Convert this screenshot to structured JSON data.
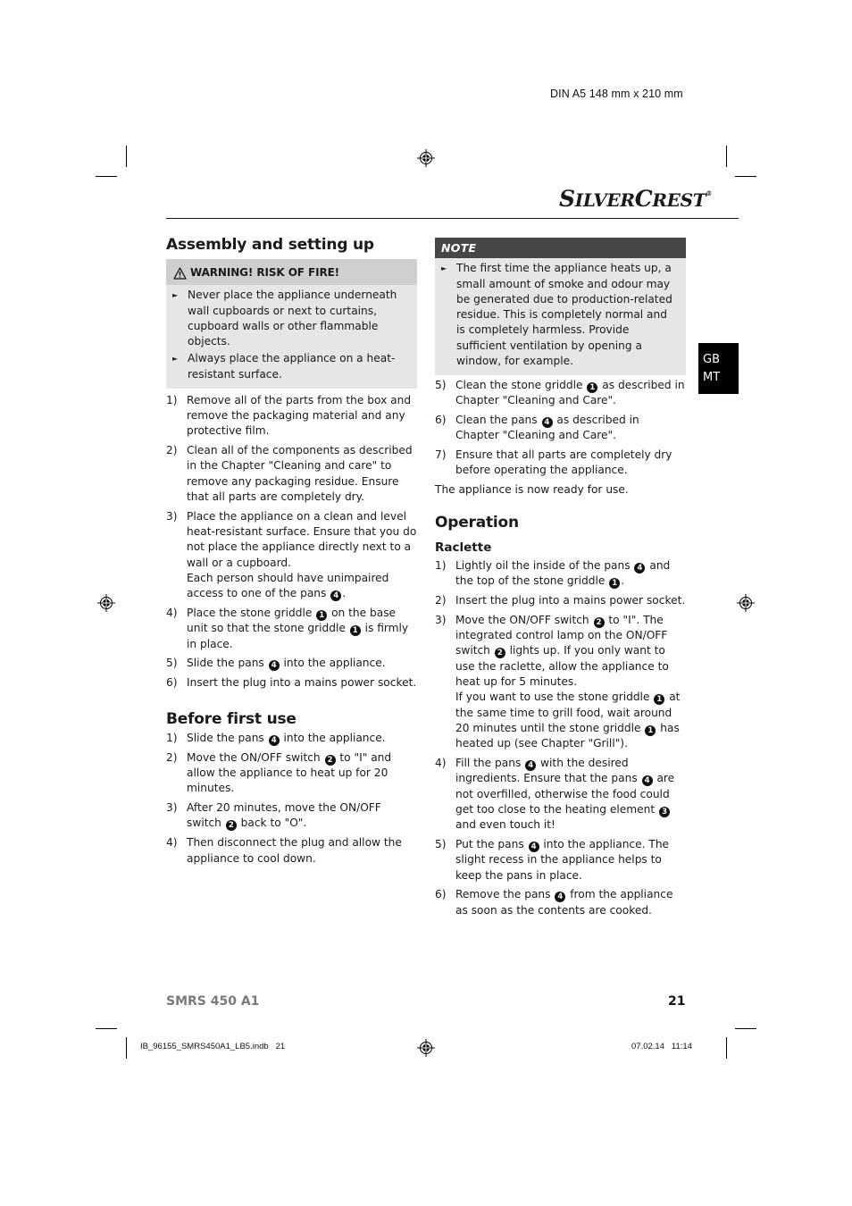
{
  "print_info": {
    "format": "DIN A5 148 mm x 210 mm",
    "slug_file": "IB_96155_SMRS450A1_LB5.indb   21",
    "slug_date": "07.02.14   11:14"
  },
  "header": {
    "brand": {
      "s": "S",
      "ilver": "ILVER",
      "c": "C",
      "rest": "REST",
      "mark": "®"
    }
  },
  "language_tab": {
    "line1": "GB",
    "line2": "MT"
  },
  "left_column": {
    "assembly": {
      "title": "Assembly and setting up",
      "warning": {
        "icon": "warning-triangle-icon",
        "title": "WARNING! RISK OF FIRE!",
        "bullets": [
          "Never place the appliance underneath wall cupboards or next to curtains, cupboard walls or other flammable objects.",
          "Always place the appliance on a heat-resistant surface."
        ]
      },
      "steps": [
        {
          "num": "1)",
          "parts": [
            {
              "t": "Remove all of the parts from the box and remove the packaging material and any protective film."
            }
          ]
        },
        {
          "num": "2)",
          "parts": [
            {
              "t": "Clean all of the components as described in the Chapter \"Cleaning and care\" to remove any packaging residue. Ensure that all parts are completely dry."
            }
          ]
        },
        {
          "num": "3)",
          "parts": [
            {
              "t": "Place the appliance on a clean and level heat-resistant surface. Ensure that you do not place the appliance directly next to a wall or a cupboard."
            },
            {
              "br": true
            },
            {
              "t": "Each person should have unimpaired access to one of the pans "
            },
            {
              "badge": "4"
            },
            {
              "t": "."
            }
          ]
        },
        {
          "num": "4)",
          "parts": [
            {
              "t": "Place the stone griddle "
            },
            {
              "badge": "1"
            },
            {
              "t": " on the base unit so that the stone griddle "
            },
            {
              "badge": "1"
            },
            {
              "t": " is firmly in place."
            }
          ]
        },
        {
          "num": "5)",
          "parts": [
            {
              "t": "Slide the pans "
            },
            {
              "badge": "4"
            },
            {
              "t": " into the appliance."
            }
          ]
        },
        {
          "num": "6)",
          "parts": [
            {
              "t": "Insert the plug into a mains power socket."
            }
          ]
        }
      ]
    },
    "before_first_use": {
      "title": "Before first use",
      "steps": [
        {
          "num": "1)",
          "parts": [
            {
              "t": "Slide the pans "
            },
            {
              "badge": "4"
            },
            {
              "t": " into the appliance."
            }
          ]
        },
        {
          "num": "2)",
          "parts": [
            {
              "t": "Move the ON/OFF switch "
            },
            {
              "badge": "2"
            },
            {
              "t": " to \"I\" and allow the appliance to heat up for 20 minutes."
            }
          ]
        },
        {
          "num": "3)",
          "parts": [
            {
              "t": "After 20 minutes, move the ON/OFF switch "
            },
            {
              "badge": "2"
            },
            {
              "t": " back to \"O\"."
            }
          ]
        },
        {
          "num": "4)",
          "parts": [
            {
              "t": "Then disconnect the plug and allow the appliance to cool down."
            }
          ]
        }
      ]
    }
  },
  "right_column": {
    "note": {
      "title": "NOTE",
      "bullets": [
        "The first time the appliance heats up, a small amount of smoke and odour may be generated due to production-related residue. This is completely normal and is completely harmless. Provide sufficient ventilation by opening a window, for example."
      ]
    },
    "steps_continued": [
      {
        "num": "5)",
        "parts": [
          {
            "t": "Clean the stone griddle "
          },
          {
            "badge": "1"
          },
          {
            "t": " as described in Chapter \"Cleaning and Care\"."
          }
        ]
      },
      {
        "num": "6)",
        "parts": [
          {
            "t": "Clean the pans "
          },
          {
            "badge": "4"
          },
          {
            "t": " as described in Chapter \"Cleaning and Care\"."
          }
        ]
      },
      {
        "num": "7)",
        "parts": [
          {
            "t": "Ensure that all parts are completely dry before operating the appliance."
          }
        ]
      }
    ],
    "ready_text": "The appliance is now ready for use.",
    "operation": {
      "title": "Operation",
      "subtitle": "Raclette",
      "steps": [
        {
          "num": "1)",
          "parts": [
            {
              "t": "Lightly oil the inside of the pans "
            },
            {
              "badge": "4"
            },
            {
              "t": " and the top of the stone griddle "
            },
            {
              "badge": "1"
            },
            {
              "t": "."
            }
          ]
        },
        {
          "num": "2)",
          "parts": [
            {
              "t": "Insert the plug into a mains power socket."
            }
          ]
        },
        {
          "num": "3)",
          "parts": [
            {
              "t": "Move the ON/OFF switch "
            },
            {
              "badge": "2"
            },
            {
              "t": " to \"I\". The integrated control lamp on the ON/OFF switch "
            },
            {
              "badge": "2"
            },
            {
              "t": " lights up. If you only want to use the raclette, allow the appliance to heat up for 5 minutes."
            },
            {
              "br": true
            },
            {
              "t": "If you want to use the stone griddle "
            },
            {
              "badge": "1"
            },
            {
              "t": " at the same time to grill food, wait around 20 minutes until the stone griddle "
            },
            {
              "badge": "1"
            },
            {
              "t": " has heated up (see Chapter \"Grill\")."
            }
          ]
        },
        {
          "num": "4)",
          "parts": [
            {
              "t": "Fill the pans "
            },
            {
              "badge": "4"
            },
            {
              "t": " with the desired ingredients. Ensure that the pans "
            },
            {
              "badge": "4"
            },
            {
              "t": " are not overfilled, otherwise the food could get too close to the heating element "
            },
            {
              "badge": "3"
            },
            {
              "t": " and even touch it!"
            }
          ]
        },
        {
          "num": "5)",
          "parts": [
            {
              "t": "Put the pans "
            },
            {
              "badge": "4"
            },
            {
              "t": " into the appliance. The slight recess in the appliance helps to keep the pans in place."
            }
          ]
        },
        {
          "num": "6)",
          "parts": [
            {
              "t": "Remove the pans "
            },
            {
              "badge": "4"
            },
            {
              "t": " from the appliance as soon as the contents are cooked."
            }
          ]
        }
      ]
    }
  },
  "footer": {
    "model": "SMRS 450 A1",
    "page_number": "21"
  }
}
